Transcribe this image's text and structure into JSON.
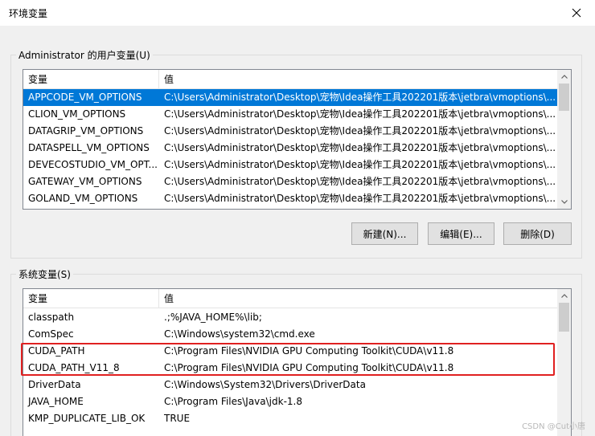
{
  "window": {
    "title": "环境变量",
    "close_icon": "close-icon"
  },
  "user_vars": {
    "group_label": "Administrator 的用户变量(U)",
    "columns": {
      "name": "变量",
      "value": "值"
    },
    "rows": [
      {
        "name": "APPCODE_VM_OPTIONS",
        "value": "C:\\Users\\Administrator\\Desktop\\宠物\\Idea操作工具202201版本\\jetbra\\vmoptions\\...",
        "selected": true
      },
      {
        "name": "CLION_VM_OPTIONS",
        "value": "C:\\Users\\Administrator\\Desktop\\宠物\\Idea操作工具202201版本\\jetbra\\vmoptions\\..."
      },
      {
        "name": "DATAGRIP_VM_OPTIONS",
        "value": "C:\\Users\\Administrator\\Desktop\\宠物\\Idea操作工具202201版本\\jetbra\\vmoptions\\..."
      },
      {
        "name": "DATASPELL_VM_OPTIONS",
        "value": "C:\\Users\\Administrator\\Desktop\\宠物\\Idea操作工具202201版本\\jetbra\\vmoptions\\..."
      },
      {
        "name": "DEVECOSTUDIO_VM_OPT...",
        "value": "C:\\Users\\Administrator\\Desktop\\宠物\\Idea操作工具202201版本\\jetbra\\vmoptions\\..."
      },
      {
        "name": "GATEWAY_VM_OPTIONS",
        "value": "C:\\Users\\Administrator\\Desktop\\宠物\\Idea操作工具202201版本\\jetbra\\vmoptions\\..."
      },
      {
        "name": "GOLAND_VM_OPTIONS",
        "value": "C:\\Users\\Administrator\\Desktop\\宠物\\Idea操作工具202201版本\\jetbra\\vmoptions\\..."
      }
    ],
    "buttons": {
      "new": "新建(N)...",
      "edit": "编辑(E)...",
      "delete": "删除(D)"
    }
  },
  "system_vars": {
    "group_label": "系统变量(S)",
    "columns": {
      "name": "变量",
      "value": "值"
    },
    "rows": [
      {
        "name": "classpath",
        "value": ".;%JAVA_HOME%\\lib;"
      },
      {
        "name": "ComSpec",
        "value": "C:\\Windows\\system32\\cmd.exe"
      },
      {
        "name": "CUDA_PATH",
        "value": "C:\\Program Files\\NVIDIA GPU Computing Toolkit\\CUDA\\v11.8"
      },
      {
        "name": "CUDA_PATH_V11_8",
        "value": "C:\\Program Files\\NVIDIA GPU Computing Toolkit\\CUDA\\v11.8"
      },
      {
        "name": "DriverData",
        "value": "C:\\Windows\\System32\\Drivers\\DriverData"
      },
      {
        "name": "JAVA_HOME",
        "value": "C:\\Program Files\\Java\\jdk-1.8"
      },
      {
        "name": "KMP_DUPLICATE_LIB_OK",
        "value": "TRUE"
      }
    ]
  },
  "watermark": "CSDN @Cut小唐",
  "colors": {
    "selection": "#0078d7",
    "highlight": "#e02020"
  }
}
